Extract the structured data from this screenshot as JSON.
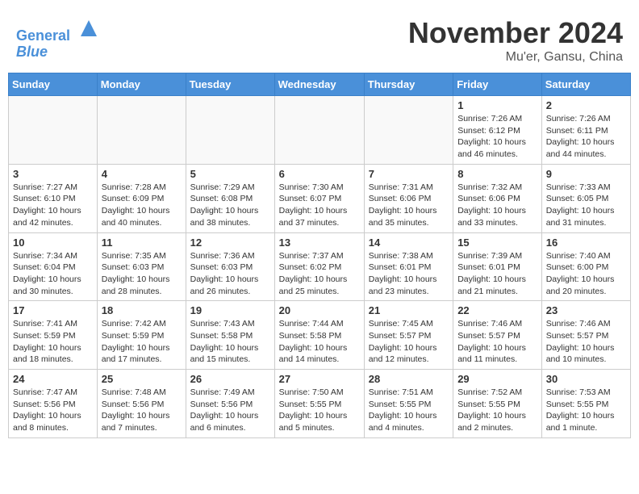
{
  "header": {
    "logo_line1": "General",
    "logo_line2": "Blue",
    "month": "November 2024",
    "location": "Mu'er, Gansu, China"
  },
  "weekdays": [
    "Sunday",
    "Monday",
    "Tuesday",
    "Wednesday",
    "Thursday",
    "Friday",
    "Saturday"
  ],
  "weeks": [
    [
      {
        "day": "",
        "info": ""
      },
      {
        "day": "",
        "info": ""
      },
      {
        "day": "",
        "info": ""
      },
      {
        "day": "",
        "info": ""
      },
      {
        "day": "",
        "info": ""
      },
      {
        "day": "1",
        "info": "Sunrise: 7:26 AM\nSunset: 6:12 PM\nDaylight: 10 hours and 46 minutes."
      },
      {
        "day": "2",
        "info": "Sunrise: 7:26 AM\nSunset: 6:11 PM\nDaylight: 10 hours and 44 minutes."
      }
    ],
    [
      {
        "day": "3",
        "info": "Sunrise: 7:27 AM\nSunset: 6:10 PM\nDaylight: 10 hours and 42 minutes."
      },
      {
        "day": "4",
        "info": "Sunrise: 7:28 AM\nSunset: 6:09 PM\nDaylight: 10 hours and 40 minutes."
      },
      {
        "day": "5",
        "info": "Sunrise: 7:29 AM\nSunset: 6:08 PM\nDaylight: 10 hours and 38 minutes."
      },
      {
        "day": "6",
        "info": "Sunrise: 7:30 AM\nSunset: 6:07 PM\nDaylight: 10 hours and 37 minutes."
      },
      {
        "day": "7",
        "info": "Sunrise: 7:31 AM\nSunset: 6:06 PM\nDaylight: 10 hours and 35 minutes."
      },
      {
        "day": "8",
        "info": "Sunrise: 7:32 AM\nSunset: 6:06 PM\nDaylight: 10 hours and 33 minutes."
      },
      {
        "day": "9",
        "info": "Sunrise: 7:33 AM\nSunset: 6:05 PM\nDaylight: 10 hours and 31 minutes."
      }
    ],
    [
      {
        "day": "10",
        "info": "Sunrise: 7:34 AM\nSunset: 6:04 PM\nDaylight: 10 hours and 30 minutes."
      },
      {
        "day": "11",
        "info": "Sunrise: 7:35 AM\nSunset: 6:03 PM\nDaylight: 10 hours and 28 minutes."
      },
      {
        "day": "12",
        "info": "Sunrise: 7:36 AM\nSunset: 6:03 PM\nDaylight: 10 hours and 26 minutes."
      },
      {
        "day": "13",
        "info": "Sunrise: 7:37 AM\nSunset: 6:02 PM\nDaylight: 10 hours and 25 minutes."
      },
      {
        "day": "14",
        "info": "Sunrise: 7:38 AM\nSunset: 6:01 PM\nDaylight: 10 hours and 23 minutes."
      },
      {
        "day": "15",
        "info": "Sunrise: 7:39 AM\nSunset: 6:01 PM\nDaylight: 10 hours and 21 minutes."
      },
      {
        "day": "16",
        "info": "Sunrise: 7:40 AM\nSunset: 6:00 PM\nDaylight: 10 hours and 20 minutes."
      }
    ],
    [
      {
        "day": "17",
        "info": "Sunrise: 7:41 AM\nSunset: 5:59 PM\nDaylight: 10 hours and 18 minutes."
      },
      {
        "day": "18",
        "info": "Sunrise: 7:42 AM\nSunset: 5:59 PM\nDaylight: 10 hours and 17 minutes."
      },
      {
        "day": "19",
        "info": "Sunrise: 7:43 AM\nSunset: 5:58 PM\nDaylight: 10 hours and 15 minutes."
      },
      {
        "day": "20",
        "info": "Sunrise: 7:44 AM\nSunset: 5:58 PM\nDaylight: 10 hours and 14 minutes."
      },
      {
        "day": "21",
        "info": "Sunrise: 7:45 AM\nSunset: 5:57 PM\nDaylight: 10 hours and 12 minutes."
      },
      {
        "day": "22",
        "info": "Sunrise: 7:46 AM\nSunset: 5:57 PM\nDaylight: 10 hours and 11 minutes."
      },
      {
        "day": "23",
        "info": "Sunrise: 7:46 AM\nSunset: 5:57 PM\nDaylight: 10 hours and 10 minutes."
      }
    ],
    [
      {
        "day": "24",
        "info": "Sunrise: 7:47 AM\nSunset: 5:56 PM\nDaylight: 10 hours and 8 minutes."
      },
      {
        "day": "25",
        "info": "Sunrise: 7:48 AM\nSunset: 5:56 PM\nDaylight: 10 hours and 7 minutes."
      },
      {
        "day": "26",
        "info": "Sunrise: 7:49 AM\nSunset: 5:56 PM\nDaylight: 10 hours and 6 minutes."
      },
      {
        "day": "27",
        "info": "Sunrise: 7:50 AM\nSunset: 5:55 PM\nDaylight: 10 hours and 5 minutes."
      },
      {
        "day": "28",
        "info": "Sunrise: 7:51 AM\nSunset: 5:55 PM\nDaylight: 10 hours and 4 minutes."
      },
      {
        "day": "29",
        "info": "Sunrise: 7:52 AM\nSunset: 5:55 PM\nDaylight: 10 hours and 2 minutes."
      },
      {
        "day": "30",
        "info": "Sunrise: 7:53 AM\nSunset: 5:55 PM\nDaylight: 10 hours and 1 minute."
      }
    ]
  ]
}
